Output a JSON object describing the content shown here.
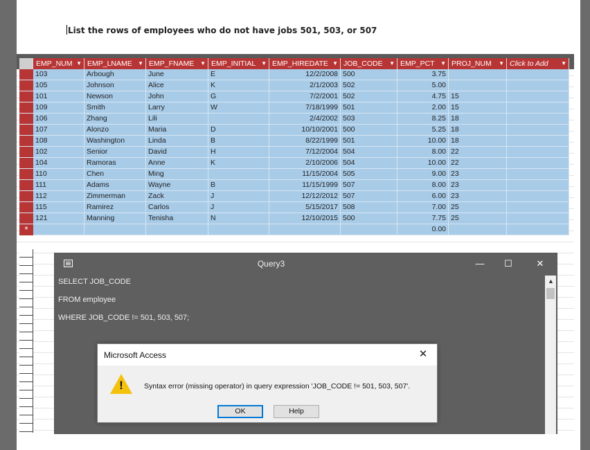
{
  "document": {
    "instruction": "List the rows of employees who do not have jobs 501, 503, or 507"
  },
  "table": {
    "columns": [
      {
        "label": "EMP_NUM",
        "w": 74,
        "align": "l"
      },
      {
        "label": "EMP_LNAME",
        "w": 89,
        "align": "l"
      },
      {
        "label": "EMP_FNAME",
        "w": 90,
        "align": "l"
      },
      {
        "label": "EMP_INITIAL",
        "w": 88,
        "align": "l"
      },
      {
        "label": "EMP_HIREDATE",
        "w": 103,
        "align": "r"
      },
      {
        "label": "JOB_CODE",
        "w": 82,
        "align": "l"
      },
      {
        "label": "EMP_PCT",
        "w": 74,
        "align": "r"
      },
      {
        "label": "PROJ_NUM",
        "w": 84,
        "align": "l"
      }
    ],
    "add_column_label": "Click to Add",
    "new_row_marker": "*",
    "new_row_pct": "0.00",
    "rows": [
      [
        "103",
        "Arbough",
        "June",
        "E",
        "12/2/2008",
        "500",
        "3.75",
        ""
      ],
      [
        "105",
        "Johnson",
        "Alice",
        "K",
        "2/1/2003",
        "502",
        "5.00",
        ""
      ],
      [
        "101",
        "Newson",
        "John",
        "G",
        "7/2/2001",
        "502",
        "4.75",
        "15"
      ],
      [
        "109",
        "Smith",
        "Larry",
        "W",
        "7/18/1999",
        "501",
        "2.00",
        "15"
      ],
      [
        "106",
        "Zhang",
        "Lili",
        "",
        "2/4/2002",
        "503",
        "8.25",
        "18"
      ],
      [
        "107",
        "Alonzo",
        "Maria",
        "D",
        "10/10/2001",
        "500",
        "5.25",
        "18"
      ],
      [
        "108",
        "Washington",
        "Linda",
        "B",
        "8/22/1999",
        "501",
        "10.00",
        "18"
      ],
      [
        "102",
        "Senior",
        "David",
        "H",
        "7/12/2004",
        "504",
        "8.00",
        "22"
      ],
      [
        "104",
        "Ramoras",
        "Anne",
        "K",
        "2/10/2006",
        "504",
        "10.00",
        "22"
      ],
      [
        "110",
        "Chen",
        "Ming",
        "",
        "11/15/2004",
        "505",
        "9.00",
        "23"
      ],
      [
        "111",
        "Adams",
        "Wayne",
        "B",
        "11/15/1999",
        "507",
        "8.00",
        "23"
      ],
      [
        "112",
        "Zimmerman",
        "Zack",
        "J",
        "12/12/2012",
        "507",
        "6.00",
        "23"
      ],
      [
        "115",
        "Ramirez",
        "Carlos",
        "J",
        "5/15/2017",
        "508",
        "7.00",
        "25"
      ],
      [
        "121",
        "Manning",
        "Tenisha",
        "N",
        "12/10/2015",
        "500",
        "7.75",
        "25"
      ]
    ]
  },
  "query_window": {
    "title": "Query3",
    "minimize": "—",
    "maximize": "☐",
    "close": "✕",
    "sql_lines": [
      "SELECT JOB_CODE",
      "FROM employee",
      "WHERE JOB_CODE != 501, 503, 507;"
    ]
  },
  "dialog": {
    "title": "Microsoft Access",
    "close": "✕",
    "message": "Syntax error (missing operator) in query expression 'JOB_CODE != 501, 503, 507'.",
    "ok_label": "OK",
    "help_label": "Help",
    "icon": "warning-icon",
    "icon_glyph": "!",
    "icon_color": "#f4c20d"
  },
  "colors": {
    "header_red": "#b83535",
    "row_blue": "#a8cbe8",
    "window_gray": "#5f5f5f"
  }
}
